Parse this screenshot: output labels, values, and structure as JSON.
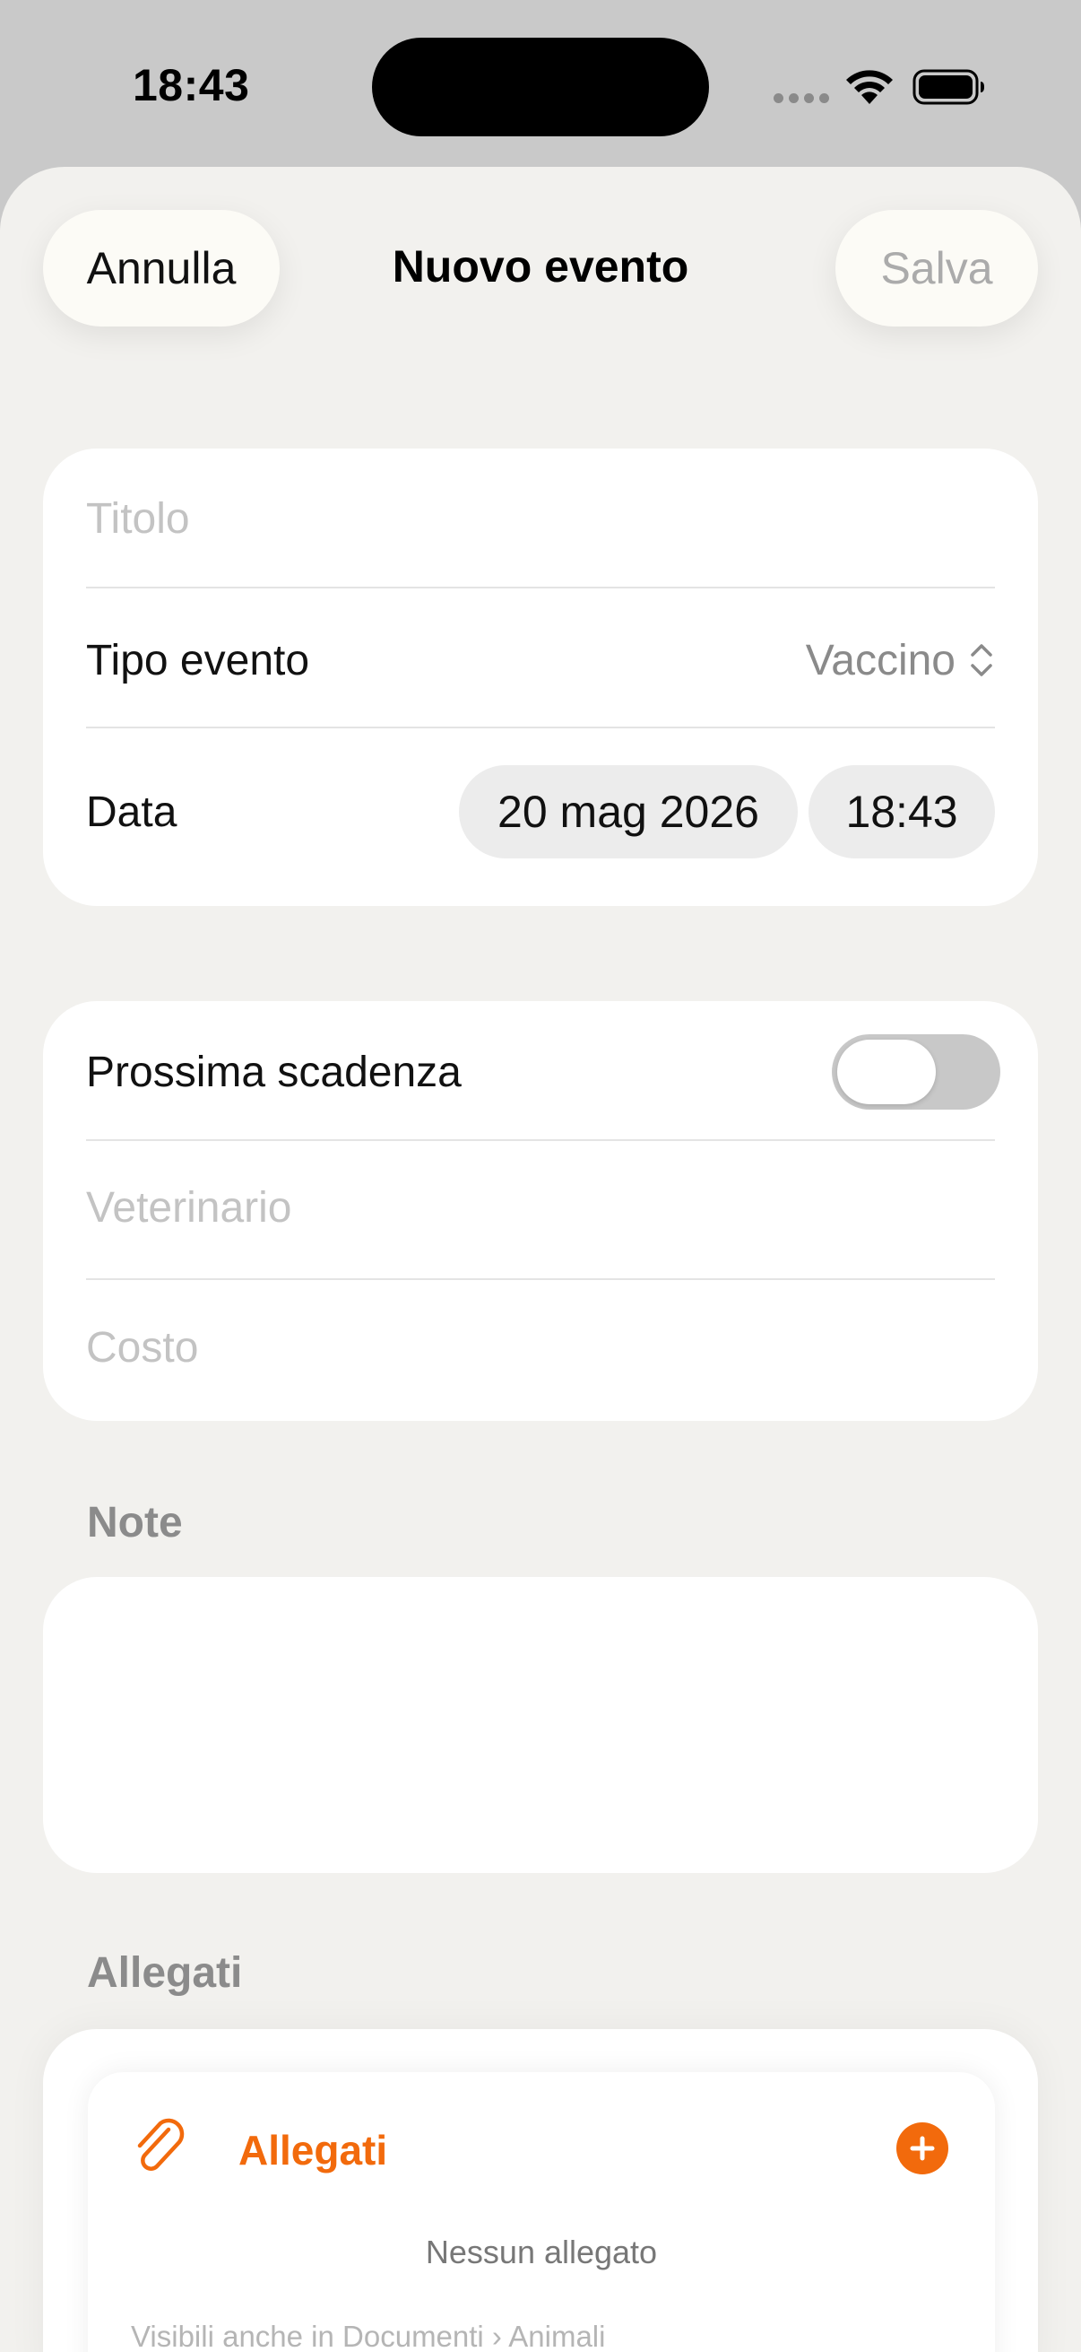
{
  "status_bar": {
    "time": "18:43"
  },
  "nav": {
    "cancel_label": "Annulla",
    "title": "Nuovo evento",
    "save_label": "Salva"
  },
  "event": {
    "title_placeholder": "Titolo",
    "type_label": "Tipo evento",
    "type_value": "Vaccino",
    "date_label": "Data",
    "date_value": "20 mag 2026",
    "time_value": "18:43"
  },
  "details": {
    "next_due_label": "Prossima scadenza",
    "next_due_enabled": false,
    "vet_placeholder": "Veterinario",
    "cost_placeholder": "Costo"
  },
  "notes": {
    "header": "Note",
    "value": ""
  },
  "attachments": {
    "section_header": "Allegati",
    "card_title": "Allegati",
    "empty_text": "Nessun allegato",
    "footer_text": "Visibili anche in Documenti › Animali"
  },
  "colors": {
    "accent": "#f26a0c",
    "sheet_bg": "#f2f1ee",
    "card_bg": "#ffffff"
  },
  "icons": [
    "wifi-icon",
    "battery-icon",
    "signal-icon",
    "chevron-updown-icon",
    "paperclip-icon",
    "plus-circle-icon"
  ]
}
